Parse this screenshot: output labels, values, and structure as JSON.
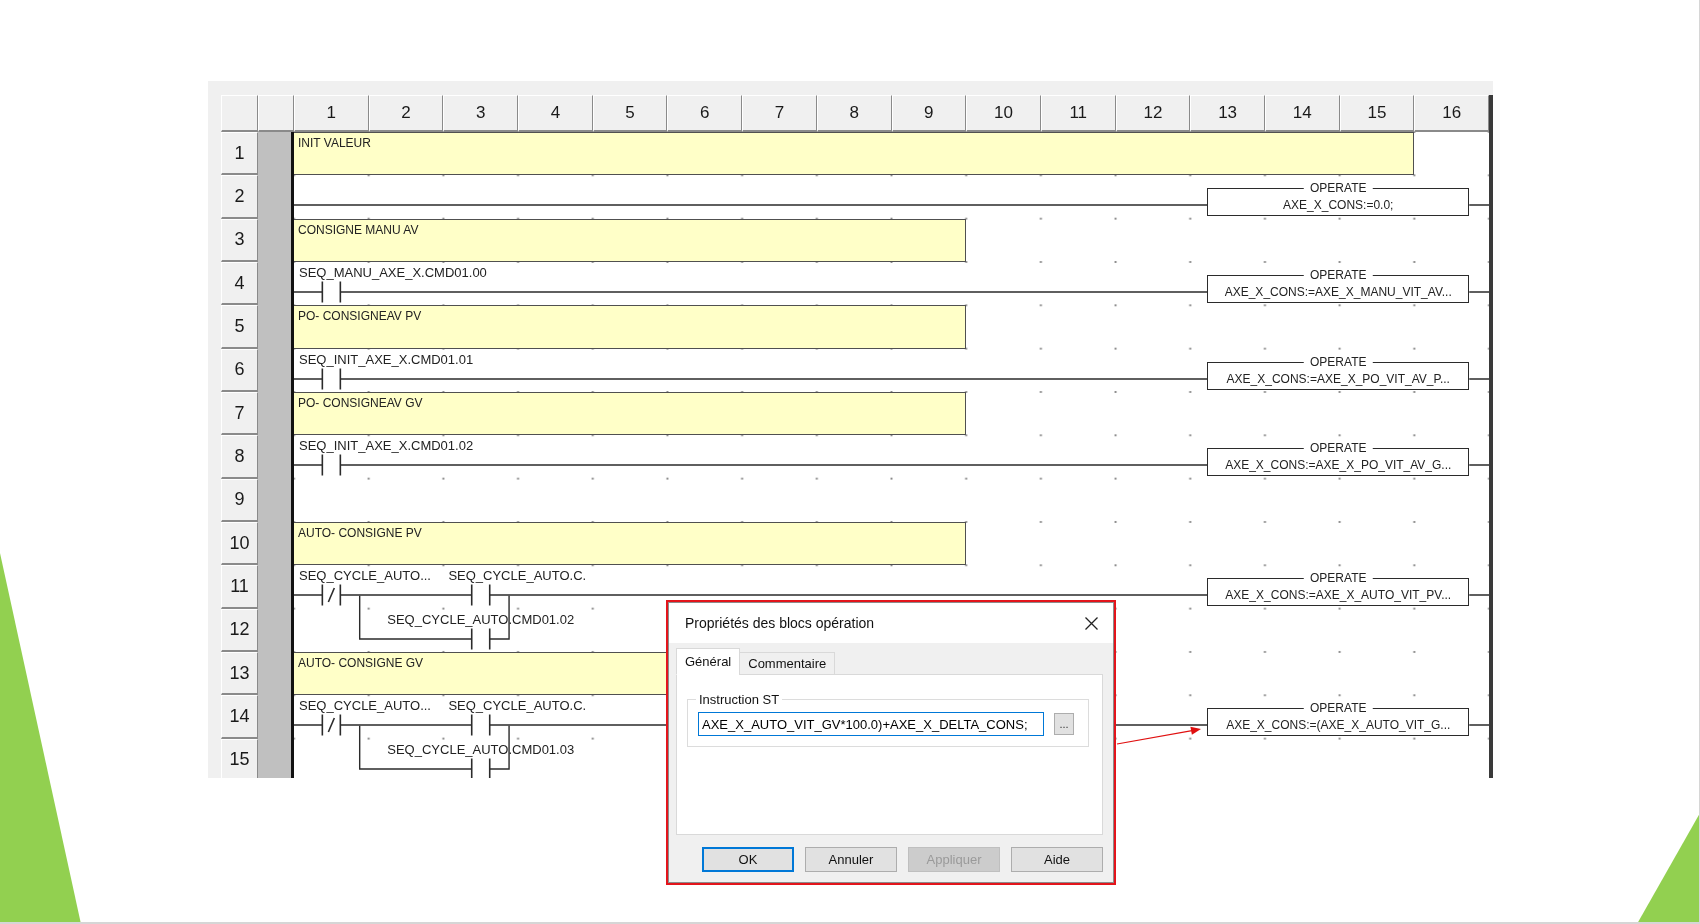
{
  "ladder": {
    "columns": [
      "1",
      "2",
      "3",
      "4",
      "5",
      "6",
      "7",
      "8",
      "9",
      "10",
      "11",
      "12",
      "13",
      "14",
      "15",
      "16"
    ],
    "rows": [
      {
        "number": "1",
        "kind": "banner",
        "text": "INIT VALEUR"
      },
      {
        "number": "2",
        "kind": "rung",
        "contacts": [],
        "operate": {
          "title": "OPERATE",
          "expression": "AXE_X_CONS:=0.0;"
        }
      },
      {
        "number": "3",
        "kind": "comment",
        "text": "CONSIGNE MANU AV"
      },
      {
        "number": "4",
        "kind": "rung",
        "contacts": [
          {
            "kind": "normally_open",
            "label": "SEQ_MANU_AXE_X.CMD01.00"
          }
        ],
        "operate": {
          "title": "OPERATE",
          "expression": "AXE_X_CONS:=AXE_X_MANU_VIT_AV..."
        }
      },
      {
        "number": "5",
        "kind": "comment",
        "text": "PO- CONSIGNEAV PV"
      },
      {
        "number": "6",
        "kind": "rung",
        "contacts": [
          {
            "kind": "normally_open",
            "label": "SEQ_INIT_AXE_X.CMD01.01"
          }
        ],
        "operate": {
          "title": "OPERATE",
          "expression": "AXE_X_CONS:=AXE_X_PO_VIT_AV_P..."
        }
      },
      {
        "number": "7",
        "kind": "comment",
        "text": "PO- CONSIGNEAV GV"
      },
      {
        "number": "8",
        "kind": "rung",
        "contacts": [
          {
            "kind": "normally_open",
            "label": "SEQ_INIT_AXE_X.CMD01.02"
          }
        ],
        "operate": {
          "title": "OPERATE",
          "expression": "AXE_X_CONS:=AXE_X_PO_VIT_AV_G..."
        }
      },
      {
        "number": "9",
        "kind": "empty"
      },
      {
        "number": "10",
        "kind": "comment",
        "text": "AUTO- CONSIGNE PV"
      },
      {
        "number": "11",
        "kind": "rung",
        "contacts": [
          {
            "kind": "normally_closed",
            "label": "SEQ_CYCLE_AUTO..."
          },
          {
            "kind": "normally_open",
            "label": "SEQ_CYCLE_AUTO.C."
          }
        ],
        "operate": {
          "title": "OPERATE",
          "expression": "AXE_X_CONS:=AXE_X_AUTO_VIT_PV..."
        }
      },
      {
        "number": "12",
        "kind": "branch",
        "contacts": [
          {
            "kind": "normally_open",
            "label": "SEQ_CYCLE_AUTO.CMD01.02"
          }
        ]
      },
      {
        "number": "13",
        "kind": "comment",
        "text": "AUTO- CONSIGNE GV"
      },
      {
        "number": "14",
        "kind": "rung",
        "contacts": [
          {
            "kind": "normally_closed",
            "label": "SEQ_CYCLE_AUTO..."
          },
          {
            "kind": "normally_open",
            "label": "SEQ_CYCLE_AUTO.C."
          }
        ],
        "operate": {
          "title": "OPERATE",
          "expression": "AXE_X_CONS:=(AXE_X_AUTO_VIT_G..."
        }
      },
      {
        "number": "15",
        "kind": "branch",
        "contacts": [
          {
            "kind": "normally_open",
            "label": "SEQ_CYCLE_AUTO.CMD01.03"
          }
        ]
      }
    ]
  },
  "dialog": {
    "title": "Propriétés des blocs opération",
    "tabs": [
      {
        "label": "Général",
        "selected": true
      },
      {
        "label": "Commentaire",
        "selected": false
      }
    ],
    "group_label": "Instruction ST",
    "instruction": "AXE_X_AUTO_VIT_GV*100.0)+AXE_X_DELTA_CONS;",
    "browse_label": "...",
    "buttons": [
      {
        "label": "OK",
        "default": true,
        "disabled": false
      },
      {
        "label": "Annuler",
        "default": false,
        "disabled": false
      },
      {
        "label": "Appliquer",
        "default": false,
        "disabled": true
      },
      {
        "label": "Aide",
        "default": false,
        "disabled": false
      }
    ]
  }
}
